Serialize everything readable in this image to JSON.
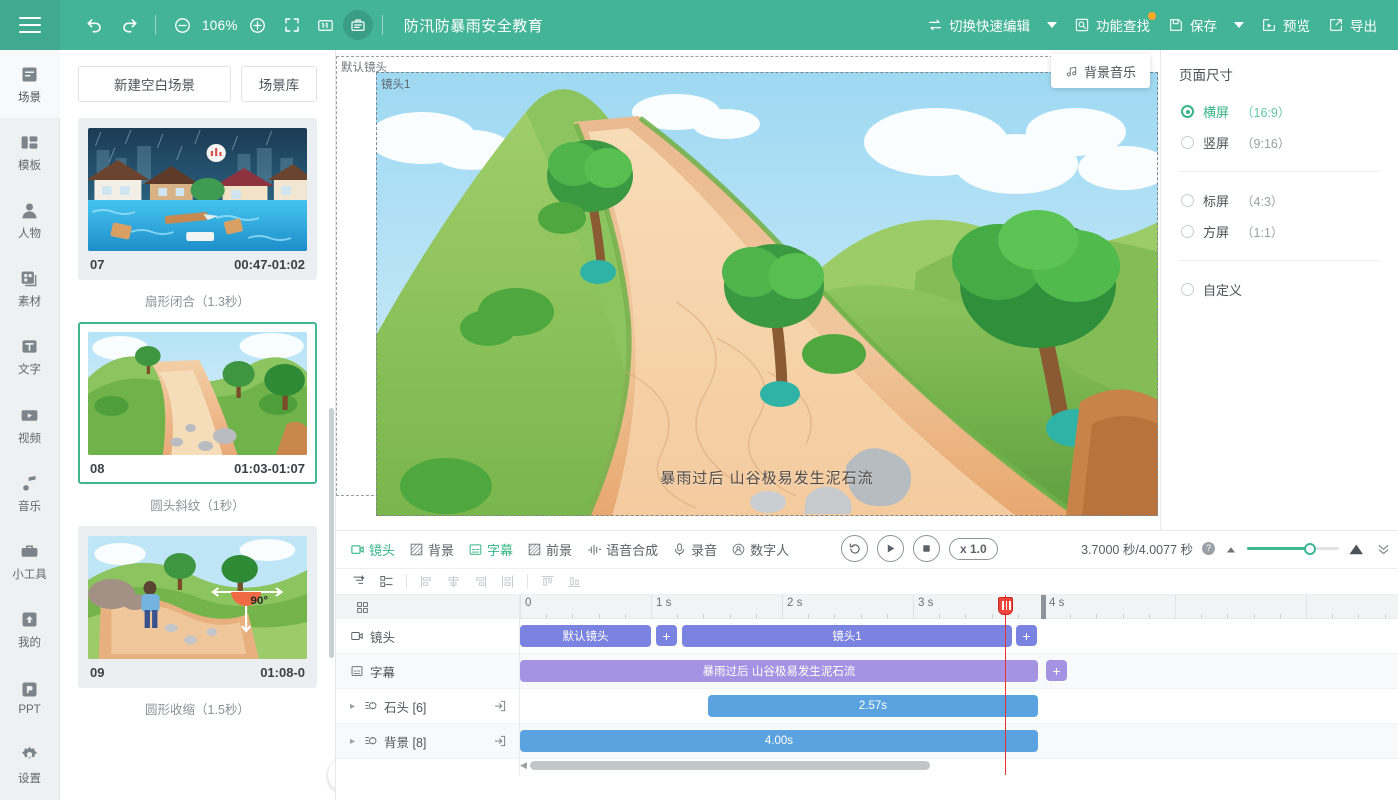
{
  "topbar": {
    "menu_icon": "hamburger-icon",
    "undo_icon": "undo-icon",
    "redo_icon": "redo-icon",
    "zoom_out_icon": "zoom-out-icon",
    "zoom_level": "106%",
    "zoom_in_icon": "zoom-in-icon",
    "fullscreen_icon": "fullscreen-icon",
    "actual_size_label": "1:1",
    "preview_frame_icon": "storyboard-icon",
    "document_title": "防汛防暴雨安全教育",
    "quick_edit_label": "切换快速编辑",
    "feature_search_label": "功能查找",
    "save_label": "保存",
    "preview_label": "预览",
    "export_label": "导出"
  },
  "rail": {
    "items": [
      {
        "label": "场景",
        "icon": "scene-icon",
        "active": true
      },
      {
        "label": "模板",
        "icon": "template-icon",
        "active": false
      },
      {
        "label": "人物",
        "icon": "character-icon",
        "active": false
      },
      {
        "label": "素材",
        "icon": "material-icon",
        "active": false
      },
      {
        "label": "文字",
        "icon": "text-icon",
        "active": false
      },
      {
        "label": "视频",
        "icon": "video-icon",
        "active": false
      },
      {
        "label": "音乐",
        "icon": "music-icon",
        "active": false
      },
      {
        "label": "小工具",
        "icon": "toolbox-icon",
        "active": false
      },
      {
        "label": "我的",
        "icon": "my-upload-icon",
        "active": false
      }
    ],
    "bottom_items": [
      {
        "label": "PPT",
        "icon": "ppt-icon"
      },
      {
        "label": "设置",
        "icon": "gear-icon"
      }
    ]
  },
  "scene_panel": {
    "new_blank_label": "新建空白场景",
    "library_label": "场景库",
    "scenes": [
      {
        "number": "07",
        "time_range": "00:47-01:02",
        "transition": "扇形闭合（1.3秒）",
        "selected": false,
        "thumb": "flood-town"
      },
      {
        "number": "08",
        "time_range": "01:03-01:07",
        "transition": "圆头斜纹（1秒）",
        "selected": true,
        "thumb": "valley-debris"
      },
      {
        "number": "09",
        "time_range": "01:08-0",
        "transition": "圆形收缩（1.5秒）",
        "selected": false,
        "thumb": "slope-person"
      }
    ],
    "scroll_top_icon": "chevron-up-icon"
  },
  "canvas": {
    "outer_camera_label": "默认镜头",
    "inner_camera_label": "镜头1",
    "subtitle_text": "暴雨过后 山谷极易发生泥石流",
    "bgm_label": "背景音乐",
    "bgm_icon": "music-note-icon"
  },
  "right_panel": {
    "title": "页面尺寸",
    "options": [
      {
        "label": "横屏",
        "ratio": "（16:9）",
        "selected": true
      },
      {
        "label": "竖屏",
        "ratio": "（9:16）",
        "selected": false
      },
      {
        "label": "标屏",
        "ratio": "（4:3）",
        "selected": false
      },
      {
        "label": "方屏",
        "ratio": "（1:1）",
        "selected": false
      },
      {
        "label": "自定义",
        "ratio": "",
        "selected": false
      }
    ]
  },
  "timeline": {
    "tools": [
      {
        "label": "镜头",
        "icon": "camera-icon",
        "active": true
      },
      {
        "label": "背景",
        "icon": "background-icon",
        "active": false
      },
      {
        "label": "字幕",
        "icon": "subtitle-icon",
        "active": true
      },
      {
        "label": "前景",
        "icon": "foreground-icon",
        "active": false
      },
      {
        "label": "语音合成",
        "icon": "tts-icon",
        "active": false
      },
      {
        "label": "录音",
        "icon": "mic-icon",
        "active": false
      },
      {
        "label": "数字人",
        "icon": "digital-human-icon",
        "active": false
      }
    ],
    "playback": {
      "replay_icon": "replay-icon",
      "play_icon": "play-icon",
      "stop_icon": "stop-icon",
      "speed_label": "x 1.0"
    },
    "time_readout": "3.7000 秒/4.0077 秒",
    "help_icon": "help-icon",
    "zoom_min_icon": "zoom-small-icon",
    "zoom_max_icon": "zoom-large-icon",
    "collapse_icon": "double-chevron-down-icon",
    "subtools": [
      {
        "icon": "filter-icon",
        "enabled": true
      },
      {
        "icon": "track-group-icon",
        "enabled": true
      },
      {
        "icon": "align-left-icon",
        "enabled": false
      },
      {
        "icon": "align-center-h-icon",
        "enabled": false
      },
      {
        "icon": "align-right-icon",
        "enabled": false
      },
      {
        "icon": "distribute-icon",
        "enabled": false
      },
      {
        "icon": "align-top-icon",
        "enabled": false
      },
      {
        "icon": "align-bottom-icon",
        "enabled": false
      }
    ],
    "ruler": {
      "labels": [
        "0",
        "1 s",
        "2 s",
        "3 s",
        "4 s"
      ],
      "playhead_seconds": 3.7,
      "total_seconds": 4.0077
    },
    "tracks": [
      {
        "label": "镜头",
        "icon": "camera-track-icon",
        "expandable": false,
        "enter_icon": null,
        "clips": [
          {
            "label": "默认镜头",
            "start": 0,
            "end": 1.0,
            "kind": "cam"
          },
          {
            "label": "镜头1",
            "start": 1.18,
            "end": 3.7,
            "kind": "cam"
          }
        ],
        "add_buttons": [
          {
            "at": 1.03,
            "kind": "cam"
          },
          {
            "at": 3.79,
            "kind": "cam"
          }
        ]
      },
      {
        "label": "字幕",
        "icon": "subtitle-track-icon",
        "expandable": false,
        "enter_icon": null,
        "clips": [
          {
            "label": "暴雨过后 山谷极易发生泥石流",
            "start": 0,
            "end": 3.7,
            "kind": "sub"
          }
        ],
        "add_buttons": [
          {
            "at": 3.79,
            "kind": "sub"
          }
        ]
      },
      {
        "label": "石头 [6]",
        "icon": "element-track-icon",
        "expandable": true,
        "enter_icon": "enter-group-icon",
        "clips": [
          {
            "label": "2.57s",
            "start": 1.43,
            "end": 4.0,
            "kind": "elem"
          }
        ],
        "add_buttons": []
      },
      {
        "label": "背景 [8]",
        "icon": "element-track-icon",
        "expandable": true,
        "enter_icon": "enter-group-icon",
        "clips": [
          {
            "label": "4.00s",
            "start": 0,
            "end": 4.0,
            "kind": "elem"
          }
        ],
        "add_buttons": []
      }
    ]
  },
  "colors": {
    "brand_green": "#44b498",
    "accent_green": "#36b585",
    "camera_clip": "#7b83e0",
    "subtitle_clip": "#a493e2",
    "element_clip": "#5ba3e0",
    "playhead_red": "#e8322b",
    "badge_orange": "#ffa826"
  }
}
